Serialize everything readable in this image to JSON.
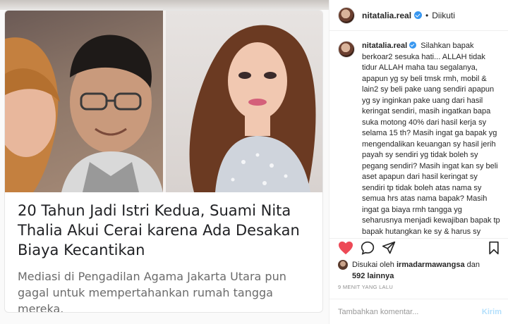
{
  "post": {
    "username": "nitatalia.real",
    "follow_separator": "•",
    "follow_status": "Diikuti",
    "caption_user": "nitatalia.real",
    "caption_text": "Silahkan bapak berkoar2 sesuka hati... ALLAH tidak tidur ALLAH maha tau segalanya, apapun yg sy beli tmsk rmh, mobil & lain2 sy beli pake uang sendiri apapun yg sy inginkan pake uang dari hasil keringat sendiri, masih ingatkan bapa suka motong 40% dari hasil kerja sy selama 15 th? Masih ingat ga bapak yg mengendalikan keuangan sy hasil jerih payah sy sendiri yg tidak boleh sy pegang sendiri? Masih ingat kan sy beli aset apapun dari hasil keringat sy sendiri tp tidak boleh atas nama sy semua hrs atas nama bapak? Masih ingat ga biaya rmh tangga yg seharusnya menjadi kewajiban bapak tp bapak hutangkan ke sy & harus sy ganti? Masih ingat ga bagaimana kali sy",
    "likes_prefix": "Disukai oleh",
    "likes_user": "irmadarmawangsa",
    "likes_and": "dan",
    "likes_count": "592 lainnya",
    "time_ago": "9 MENIT YANG LALU",
    "comment_placeholder": "Tambahkan komentar...",
    "send_label": "Kirim"
  },
  "article": {
    "title": "20 Tahun Jadi Istri Kedua, Suami Nita Thalia Akui Cerai karena Ada Desakan Biaya Kecantikan",
    "description": "Mediasi di Pengadilan Agama Jakarta Utara pun gagal untuk mempertahankan rumah tangga mereka."
  },
  "icons": {
    "verified": "verified-badge-icon",
    "like": "heart-icon",
    "comment": "comment-icon",
    "share": "send-icon",
    "save": "bookmark-icon"
  },
  "colors": {
    "like_active": "#ed4956",
    "verified": "#3897f0",
    "send_disabled": "#b2dffc"
  }
}
